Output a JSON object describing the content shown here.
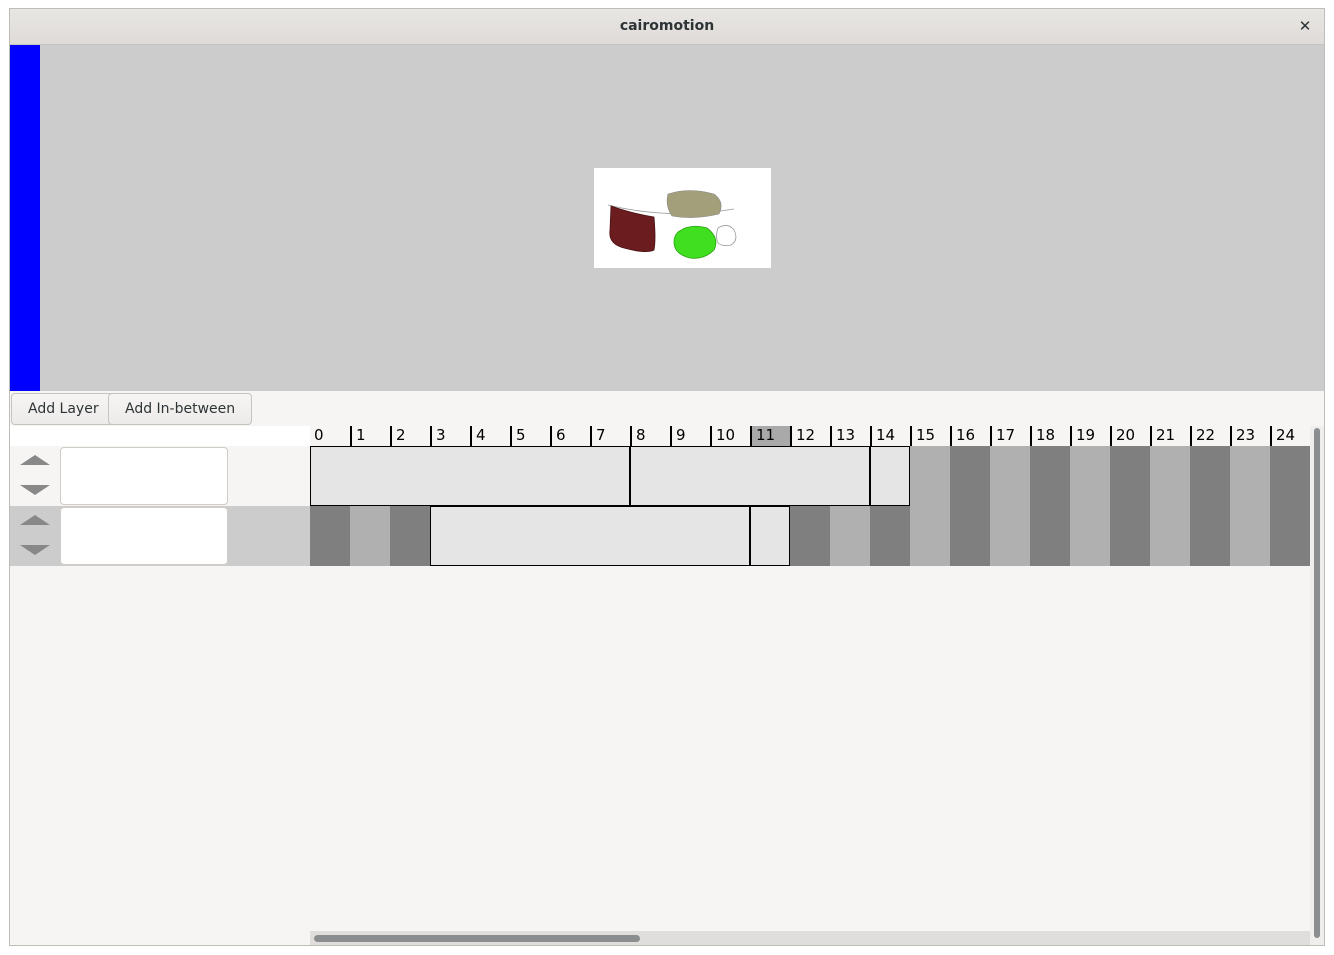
{
  "window": {
    "title": "cairomotion",
    "close_glyph": "✕"
  },
  "toolbar": {
    "add_layer_label": "Add Layer",
    "add_inbetween_label": "Add In-between"
  },
  "timeline": {
    "frame_labels": [
      "0",
      "1",
      "2",
      "3",
      "4",
      "5",
      "6",
      "7",
      "8",
      "9",
      "10",
      "11",
      "12",
      "13",
      "14",
      "15",
      "16",
      "17",
      "18",
      "19",
      "20",
      "21",
      "22",
      "23",
      "24"
    ],
    "current_frame": "11",
    "layers": [
      {
        "name": "",
        "segments": [
          {
            "from": 0,
            "to": 8,
            "kind": "tween"
          },
          {
            "from": 8,
            "to": 14,
            "kind": "tween"
          },
          {
            "from": 14,
            "to": 15,
            "kind": "tween"
          },
          {
            "from": 15,
            "to": 25,
            "kind": "blank"
          }
        ]
      },
      {
        "name": "",
        "segments": [
          {
            "from": 0,
            "to": 3,
            "kind": "blank"
          },
          {
            "from": 3,
            "to": 11,
            "kind": "tween"
          },
          {
            "from": 11,
            "to": 12,
            "kind": "tween"
          },
          {
            "from": 12,
            "to": 25,
            "kind": "blank"
          }
        ]
      }
    ]
  },
  "colors": {
    "tool_strip": "#0000ff",
    "canvas_bg": "#cccccc",
    "shape_maroon": "#6b1c1f",
    "shape_olive": "#a39f7a",
    "shape_green": "#40e020",
    "current_frame_highlight": "#a9a9a9",
    "blank_dark": "#7f7f7f",
    "blank_light": "#b0b0b0"
  },
  "icons": {
    "move_up": "triangle-up-icon",
    "move_down": "triangle-down-icon"
  }
}
